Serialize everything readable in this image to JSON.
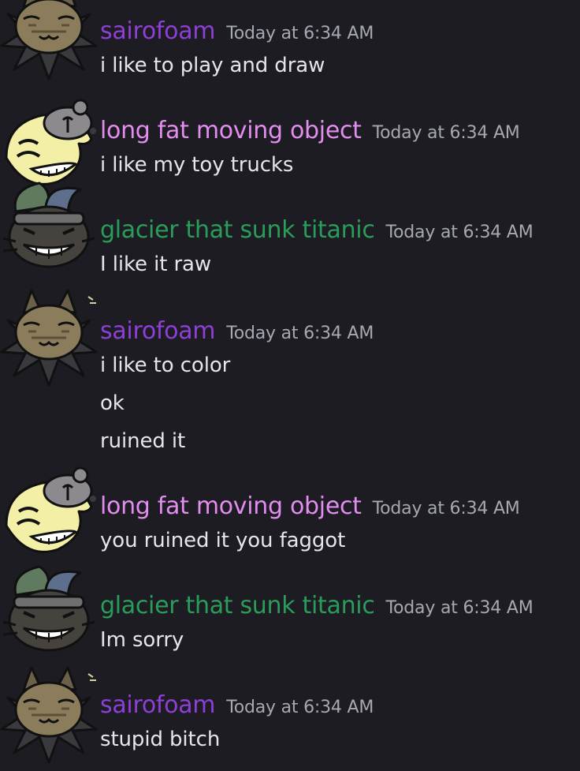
{
  "colors": {
    "background": "#1c1c22",
    "sairofoam": "#8e3fd6",
    "long_fat_moving_object": "#e48df0",
    "glacier_that_sunk_titanic": "#2a9d5a",
    "timestamp": "#a7a9b1",
    "message_text": "#e6e6ea"
  },
  "avatars": {
    "sairofoam": "horned-cat-avatar",
    "long_fat_moving_object": "grinning-yellow-mask-avatar",
    "glacier_that_sunk_titanic": "jester-hat-grin-avatar"
  },
  "messages": [
    {
      "user": "sairofoam",
      "time": "Today at 6:34 AM",
      "lines": [
        "i like to play and draw"
      ]
    },
    {
      "user": "long fat moving object",
      "time": "Today at 6:34 AM",
      "lines": [
        "i like my toy trucks"
      ]
    },
    {
      "user": "glacier that sunk titanic",
      "time": "Today at 6:34 AM",
      "lines": [
        "I like it raw"
      ]
    },
    {
      "user": "sairofoam",
      "time": "Today at 6:34 AM",
      "lines": [
        "i like to color",
        "ok",
        "ruined it"
      ]
    },
    {
      "user": "long fat moving object",
      "time": "Today at 6:34 AM",
      "lines": [
        "you ruined it you faggot"
      ]
    },
    {
      "user": "glacier that sunk titanic",
      "time": "Today at 6:34 AM",
      "lines": [
        "Im sorry"
      ]
    },
    {
      "user": "sairofoam",
      "time": "Today at 6:34 AM",
      "lines": [
        "stupid bitch"
      ]
    }
  ]
}
